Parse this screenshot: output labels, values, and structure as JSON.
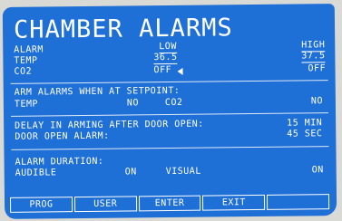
{
  "screen": {
    "title": "CHAMBER  ALARMS",
    "header": {
      "alarm": "ALARM",
      "low": "LOW",
      "high": "HIGH"
    },
    "rows": [
      {
        "label": "TEMP",
        "low": "36.5",
        "high": "37.5"
      },
      {
        "label": "CO2",
        "low": "OFF",
        "high": "OFF"
      }
    ],
    "arm": {
      "heading": "ARM ALARMS WHEN AT SETPOINT:",
      "temp_label": "TEMP",
      "temp_value": "NO",
      "co2_label": "CO2",
      "co2_value": "NO"
    },
    "delay": {
      "label": "DELAY IN ARMING AFTER DOOR OPEN:",
      "value": "15 MIN",
      "door_label": "DOOR OPEN ALARM:",
      "door_value": "45 SEC"
    },
    "duration": {
      "heading": "ALARM DURATION:",
      "audible_label": "AUDIBLE",
      "audible_value": "ON",
      "visual_label": "VISUAL",
      "visual_value": "ON"
    },
    "function_keys": [
      "PROG",
      "USER",
      "ENTER",
      "EXIT",
      ""
    ]
  },
  "colors": {
    "screen": "#1e6fd6",
    "text": "#ffffff",
    "bezel": "#d9d9d6"
  }
}
